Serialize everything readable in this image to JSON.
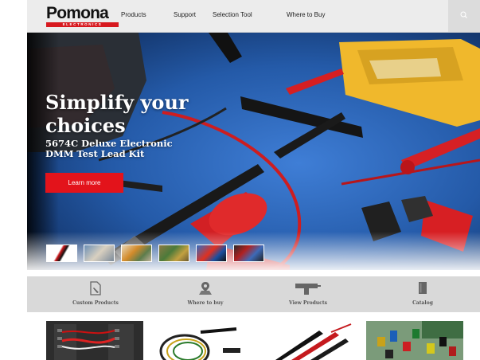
{
  "brand": {
    "name": "Pomona",
    "tagline": "ELECTRONICS",
    "accent": "#d7191f"
  },
  "nav": {
    "items": [
      "Products",
      "Support",
      "Selection Tool",
      "Where to Buy"
    ],
    "search_icon": "search-icon"
  },
  "hero": {
    "title": "Simplify your choices",
    "subtitle": "5674C Deluxe Electronic DMM Test Lead Kit",
    "button": "Learn more",
    "button_color": "#e3131b",
    "slide_count": 6
  },
  "features": [
    {
      "label": "Custom Products",
      "icon": "custom-products-icon"
    },
    {
      "label": "Where to buy",
      "icon": "map-pin-icon"
    },
    {
      "label": "View Products",
      "icon": "tool-icon"
    },
    {
      "label": "Catalog",
      "icon": "catalog-book-icon"
    }
  ],
  "product_tiles": [
    {
      "icon": "patch-panel-image"
    },
    {
      "icon": "coiled-cable-image"
    },
    {
      "icon": "test-probes-image"
    },
    {
      "icon": "connectors-image"
    }
  ]
}
